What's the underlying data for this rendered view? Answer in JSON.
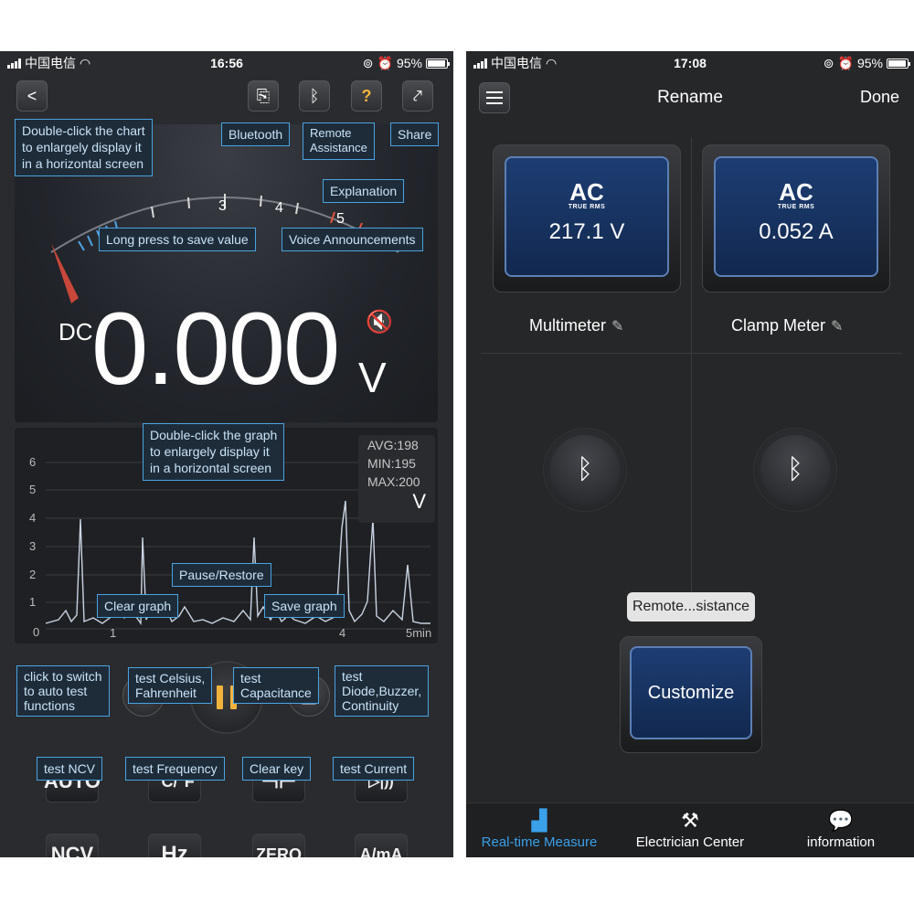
{
  "left": {
    "status": {
      "carrier": "中国电信",
      "time": "16:56",
      "battery": "95%"
    },
    "top_buttons": {
      "back": "<",
      "manual": "⎘",
      "bluetooth": "ᛒ",
      "help": "?",
      "share": "⤤"
    },
    "callouts": {
      "chart": "Double-click the chart\nto enlargely display it\nin a horizontal screen",
      "bluetooth": "Bluetooth",
      "remote": "Remote\nAssistance",
      "share": "Share",
      "explanation": "Explanation",
      "long_press": "Long press to save value",
      "voice": "Voice Announcements",
      "graph": "Double-click the graph\nto enlargely display it\nin a horizontal screen",
      "pause": "Pause/Restore",
      "clear_graph": "Clear graph",
      "save_graph": "Save graph",
      "auto": "click to switch\nto auto test\nfunctions",
      "celsius": "test Celsius,\nFahrenheit",
      "capacitance": "test\nCapacitance",
      "diode": "test\nDiode,Buzzer,\nContinuity",
      "ncv": "test NCV",
      "frequency": "test Frequency",
      "clear_key": "Clear key",
      "current": "test Current"
    },
    "gauge": {
      "ticks": [
        "3",
        "4",
        "5"
      ]
    },
    "reading": {
      "mode": "DC",
      "value": "0.000",
      "unit": "V"
    },
    "graph": {
      "stats": {
        "avg": "AVG:198",
        "min": "MIN:195",
        "max": "MAX:200",
        "unit": "V"
      },
      "y_ticks": [
        "6",
        "5",
        "4",
        "3",
        "2",
        "1",
        "0"
      ],
      "x_ticks": [
        "1",
        "4",
        "5min"
      ]
    },
    "keys": {
      "auto": "AUTO",
      "temp": "°C/°F",
      "cap": "⊣⊢",
      "diode": "▷|))",
      "ncv": "NCV",
      "hz": "Hz",
      "zero": "ZERO",
      "amp": "A/mA"
    }
  },
  "right": {
    "status": {
      "carrier": "中国电信",
      "time": "17:08",
      "battery": "95%"
    },
    "header": {
      "title": "Rename",
      "done": "Done"
    },
    "devices": [
      {
        "mode": "AC",
        "rms": "TRUE RMS",
        "reading": "217.1 V",
        "name": "Multimeter"
      },
      {
        "mode": "AC",
        "rms": "TRUE RMS",
        "reading": "0.052 A",
        "name": "Clamp Meter"
      }
    ],
    "remote_tooltip": "Remote...sistance",
    "customize": "Customize",
    "tabs": [
      {
        "label": "Real-time Measure",
        "icon": "meter-icon"
      },
      {
        "label": "Electrician Center",
        "icon": "electrician-icon"
      },
      {
        "label": "information",
        "icon": "chat-icon"
      }
    ]
  }
}
